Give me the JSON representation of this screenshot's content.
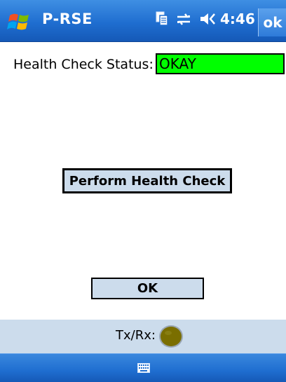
{
  "titlebar": {
    "app_title": "P-RSE",
    "time": "4:46",
    "ok_label": "ok",
    "icons": [
      "windows-start-icon",
      "copy-icon",
      "connectivity-icon",
      "speaker-icon"
    ]
  },
  "health": {
    "status_label": "Health Check Status:",
    "status_value": "OKAY",
    "status_color": "#00ff00",
    "perform_label": "Perform Health Check"
  },
  "dialog": {
    "ok_label": "OK"
  },
  "txrx": {
    "label": "Tx/Rx:",
    "led_color": "#7a6e00"
  },
  "menubar": {
    "icons": [
      "keyboard-icon"
    ]
  },
  "colors": {
    "titlebar": "#1f6ed0",
    "button_bg": "#ccdcec"
  }
}
